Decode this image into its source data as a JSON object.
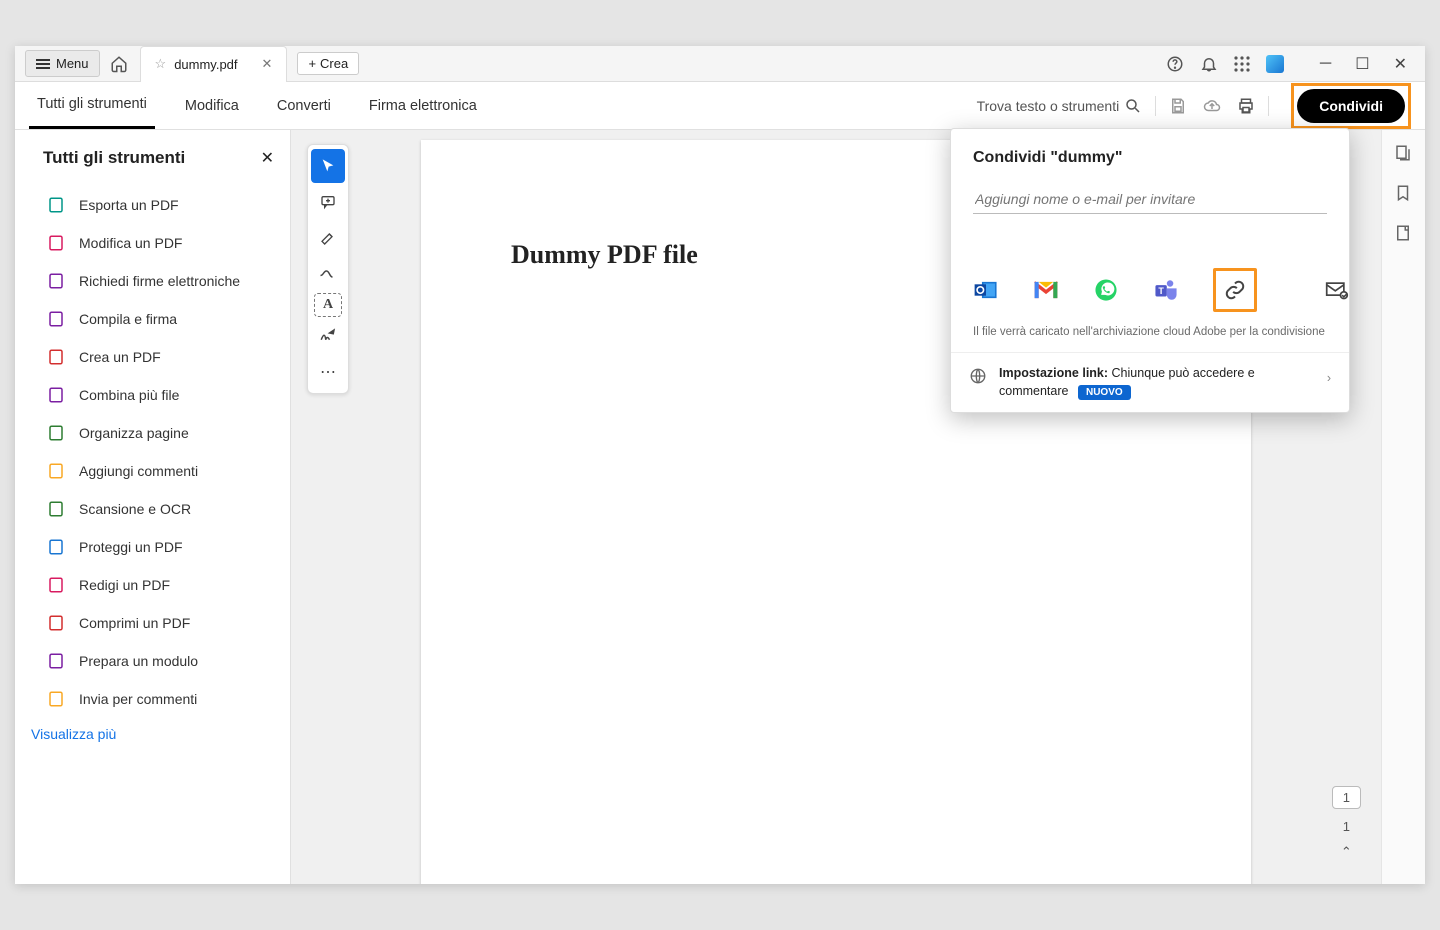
{
  "titlebar": {
    "menu_label": "Menu",
    "tab_filename": "dummy.pdf",
    "create_label": "Crea"
  },
  "nav": {
    "tabs": [
      "Tutti gli strumenti",
      "Modifica",
      "Converti",
      "Firma elettronica"
    ],
    "search_hint": "Trova testo o strumenti",
    "share_label": "Condividi"
  },
  "sidebar": {
    "title": "Tutti gli strumenti",
    "items": [
      {
        "label": "Esporta un PDF",
        "color": "#009688"
      },
      {
        "label": "Modifica un PDF",
        "color": "#d81b60"
      },
      {
        "label": "Richiedi firme elettroniche",
        "color": "#7b1fa2"
      },
      {
        "label": "Compila e firma",
        "color": "#7b1fa2"
      },
      {
        "label": "Crea un PDF",
        "color": "#d32f2f"
      },
      {
        "label": "Combina più file",
        "color": "#7b1fa2"
      },
      {
        "label": "Organizza pagine",
        "color": "#2e7d32"
      },
      {
        "label": "Aggiungi commenti",
        "color": "#f9a825"
      },
      {
        "label": "Scansione e OCR",
        "color": "#2e7d32"
      },
      {
        "label": "Proteggi un PDF",
        "color": "#1976d2"
      },
      {
        "label": "Redigi un PDF",
        "color": "#d81b60"
      },
      {
        "label": "Comprimi un PDF",
        "color": "#d32f2f"
      },
      {
        "label": "Prepara un modulo",
        "color": "#7b1fa2"
      },
      {
        "label": "Invia per commenti",
        "color": "#f9a825"
      }
    ],
    "view_more": "Visualizza più"
  },
  "document": {
    "heading": "Dummy PDF file"
  },
  "share_popover": {
    "title": "Condividi \"dummy\"",
    "input_placeholder": "Aggiungi nome o e-mail per invitare",
    "note": "Il file verrà caricato nell'archiviazione cloud Adobe per la condivisione",
    "link_setting_label": "Impostazione link:",
    "link_setting_value": "Chiunque può accedere e commentare",
    "badge": "NUOVO",
    "icons": [
      "outlook",
      "gmail",
      "whatsapp",
      "teams",
      "link",
      "mail-settings"
    ]
  },
  "page_indicator": {
    "current": "1",
    "total": "1"
  }
}
